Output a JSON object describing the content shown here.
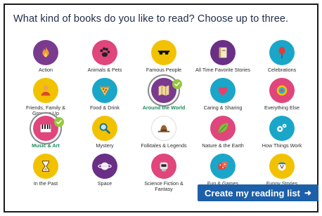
{
  "title": "What kind of books do you like to read? Choose up to three.",
  "categories": [
    {
      "label": "Action",
      "icon": "flame-icon",
      "color": "#7a3b8f",
      "selected": false
    },
    {
      "label": "Animals & Pets",
      "icon": "paw-icon",
      "color": "#e0457b",
      "selected": false
    },
    {
      "label": "Famous People",
      "icon": "sunglasses-icon",
      "color": "#f2c200",
      "selected": false
    },
    {
      "label": "All Time Favorite Stories",
      "icon": "book-icon",
      "color": "#6a2f86",
      "selected": false
    },
    {
      "label": "Celebrations",
      "icon": "balloon-icon",
      "color": "#1aa6c9",
      "selected": false
    },
    {
      "label": "Friends, Family & Growing Up",
      "icon": "people-icon",
      "color": "#f2c200",
      "selected": false
    },
    {
      "label": "Food & Drink",
      "icon": "pizza-icon",
      "color": "#1aa6c9",
      "selected": false
    },
    {
      "label": "Around the World",
      "icon": "map-icon",
      "color": "#7a3b8f",
      "selected": true
    },
    {
      "label": "Caring & Sharing",
      "icon": "heart-icon",
      "color": "#1aa6c9",
      "selected": false
    },
    {
      "label": "Everything Else",
      "icon": "target-icon",
      "color": "#e0457b",
      "selected": false
    },
    {
      "label": "Music & Art",
      "icon": "piano-icon",
      "color": "#e0457b",
      "selected": true
    },
    {
      "label": "Mystery",
      "icon": "magnifier-icon",
      "color": "#f2c200",
      "selected": false
    },
    {
      "label": "Folktales & Legends",
      "icon": "hat-icon",
      "color": "#ffffff",
      "selected": false
    },
    {
      "label": "Nature & the Earth",
      "icon": "leaf-icon",
      "color": "#e0457b",
      "selected": false
    },
    {
      "label": "How Things Work",
      "icon": "gears-icon",
      "color": "#1aa6c9",
      "selected": false
    },
    {
      "label": "In the Past",
      "icon": "hourglass-icon",
      "color": "#f2c200",
      "selected": false
    },
    {
      "label": "Space",
      "icon": "planet-icon",
      "color": "#6a2f86",
      "selected": false
    },
    {
      "label": "Science Fiction & Fantasy",
      "icon": "robot-icon",
      "color": "#e0457b",
      "selected": false
    },
    {
      "label": "Fun & Games",
      "icon": "dice-icon",
      "color": "#1aa6c9",
      "selected": false
    },
    {
      "label": "Funny Stories",
      "icon": "clown-icon",
      "color": "#f2c200",
      "selected": false
    }
  ],
  "cta": {
    "label": "Create my reading list",
    "arrow": "➜"
  }
}
